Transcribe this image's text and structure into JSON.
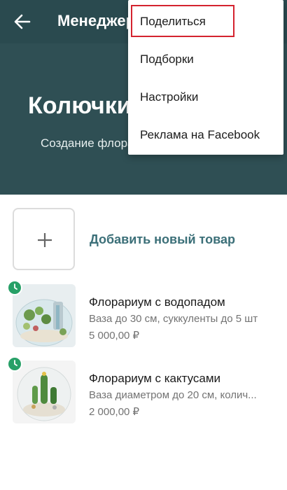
{
  "appbar": {
    "title": "Менеджер"
  },
  "hero": {
    "title": "Колючки",
    "subtitle": "Создание флорариумов"
  },
  "menu": {
    "items": [
      {
        "label": "Поделиться"
      },
      {
        "label": "Подборки"
      },
      {
        "label": "Настройки"
      },
      {
        "label": "Реклама на Facebook"
      }
    ]
  },
  "catalog": {
    "add_label": "Добавить новый товар",
    "products": [
      {
        "name": "Флорариум с водопадом",
        "description": "Ваза до 30 см, суккуленты до 5 шт",
        "price": "5 000,00 ₽"
      },
      {
        "name": "Флорариум с кактусами",
        "description": "Ваза диаметром до 20 см, колич...",
        "price": "2 000,00 ₽"
      }
    ]
  },
  "colors": {
    "header": "#2a4a4f",
    "accent": "#3b6f78",
    "badge": "#27a067",
    "highlight": "#d4232f"
  }
}
